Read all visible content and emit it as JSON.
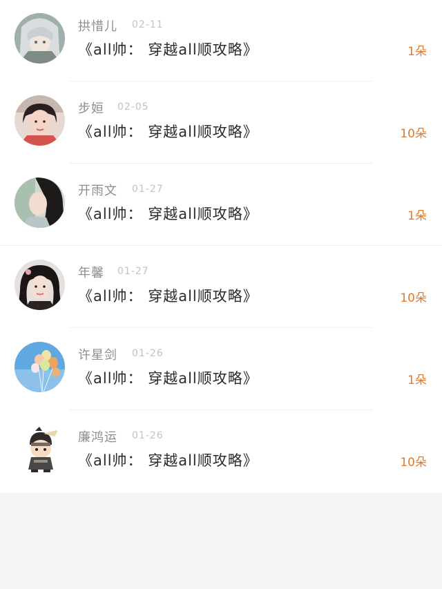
{
  "list": {
    "items": [
      {
        "name": "拱惜儿",
        "date": "02-11",
        "title": "《all帅： 穿越all顺攻略》",
        "gift": "1朵",
        "avatar": "anime-girl-avatar"
      },
      {
        "name": "步姮",
        "date": "02-05",
        "title": "《all帅： 穿越all顺攻略》",
        "gift": "10朵",
        "avatar": "girl-photo-avatar"
      },
      {
        "name": "开雨文",
        "date": "01-27",
        "title": "《all帅： 穿越all顺攻略》",
        "gift": "1朵",
        "avatar": "girl-profile-avatar"
      },
      {
        "name": "年馨",
        "date": "01-27",
        "title": "《all帅： 穿越all顺攻略》",
        "gift": "10朵",
        "avatar": "girl-selfie-avatar"
      },
      {
        "name": "许星剑",
        "date": "01-26",
        "title": "《all帅： 穿越all顺攻略》",
        "gift": "1朵",
        "avatar": "balloons-avatar"
      },
      {
        "name": "廉鸿运",
        "date": "01-26",
        "title": "《all帅： 穿越all顺攻略》",
        "gift": "10朵",
        "avatar": "cartoon-ninja-avatar"
      }
    ]
  },
  "colors": {
    "gift": "#e07a2c",
    "name": "#8e8e8e",
    "date": "#c2c2c2",
    "title": "#2b2b2b",
    "background": "#f6f5f5"
  }
}
